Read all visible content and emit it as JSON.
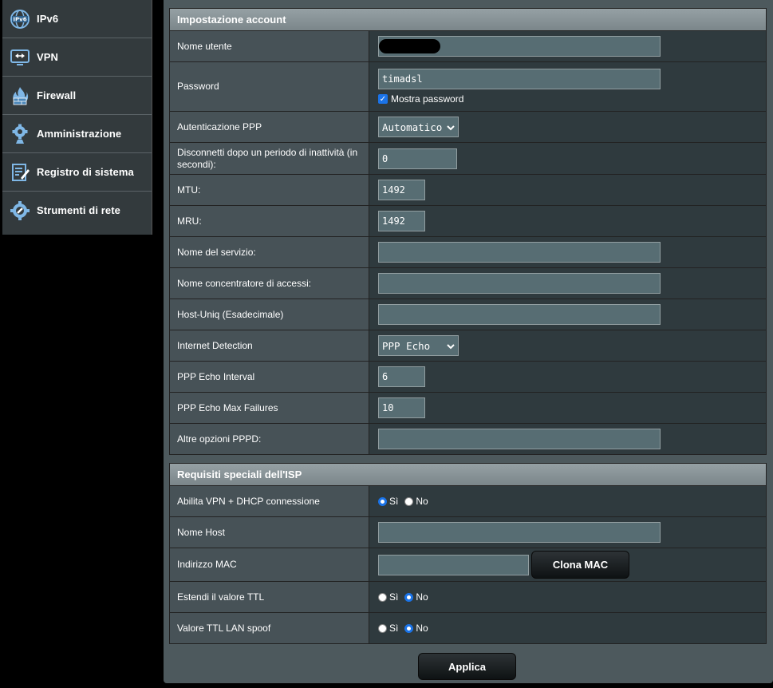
{
  "sidebar": {
    "items": [
      {
        "label": "IPv6",
        "icon": "ipv6-icon"
      },
      {
        "label": "VPN",
        "icon": "vpn-icon"
      },
      {
        "label": "Firewall",
        "icon": "firewall-icon"
      },
      {
        "label": "Amministrazione",
        "icon": "gear-icon"
      },
      {
        "label": "Registro di sistema",
        "icon": "log-icon"
      },
      {
        "label": "Strumenti di rete",
        "icon": "network-tools-icon"
      }
    ]
  },
  "account": {
    "title": "Impostazione account",
    "username_label": "Nome utente",
    "password_label": "Password",
    "password_value": "timadsl",
    "show_password_label": "Mostra password",
    "auth_label": "Autenticazione PPP",
    "auth_value": "Automatico",
    "idle_label": "Disconnetti dopo un periodo di inattività (in secondi):",
    "idle_value": "0",
    "mtu_label": "MTU:",
    "mtu_value": "1492",
    "mru_label": "MRU:",
    "mru_value": "1492",
    "service_label": "Nome del servizio:",
    "ac_label": "Nome concentratore di accessi:",
    "hostuniq_label": "Host-Uniq (Esadecimale)",
    "detection_label": "Internet Detection",
    "detection_value": "PPP Echo",
    "echo_interval_label": "PPP Echo Interval",
    "echo_interval_value": "6",
    "echo_fail_label": "PPP Echo Max Failures",
    "echo_fail_value": "10",
    "pppd_label": "Altre opzioni PPPD:"
  },
  "isp": {
    "title": "Requisiti speciali dell'ISP",
    "vpn_dhcp_label": "Abilita VPN + DHCP connessione",
    "hostname_label": "Nome Host",
    "mac_label": "Indirizzo MAC",
    "clone_mac_label": "Clona MAC",
    "ttl_label": "Estendi il valore TTL",
    "ttl_spoof_label": "Valore TTL LAN spoof",
    "yes": "Sì",
    "no": "No"
  },
  "apply_label": "Applica",
  "colors": {
    "accent": "#1a73e8",
    "panel": "#4d595d"
  }
}
